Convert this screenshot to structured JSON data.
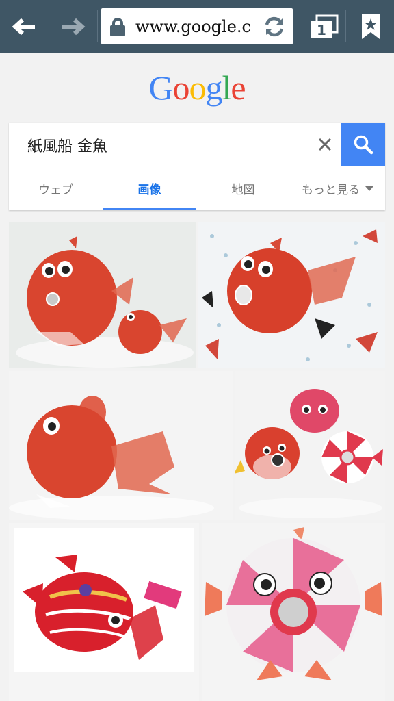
{
  "browser": {
    "url": "www.google.c",
    "tab_count": "1",
    "icons": [
      "back-arrow-icon",
      "forward-arrow-icon",
      "lock-icon",
      "reload-icon",
      "tabs-icon",
      "bookmark-icon"
    ]
  },
  "google": {
    "logo": [
      "G",
      "o",
      "o",
      "g",
      "l",
      "e"
    ],
    "logo_colors": [
      "#4285f4",
      "#ea4335",
      "#fbbc05",
      "#4285f4",
      "#34a853",
      "#ea4335"
    ]
  },
  "search": {
    "query": "紙風船 金魚",
    "accent": "#4285f4"
  },
  "tabs": {
    "web": "ウェブ",
    "images": "画像",
    "maps": "地図",
    "more": "もっと見る"
  },
  "results": {
    "images": [
      {
        "alt": "paper balloon goldfish pair"
      },
      {
        "alt": "paper balloon goldfish on tenugui"
      },
      {
        "alt": "paper balloon goldfish side view"
      },
      {
        "alt": "three paper balloon pufferfish"
      },
      {
        "alt": "red paper balloon goldfish with package"
      },
      {
        "alt": "pink paper balloon pufferfish"
      }
    ]
  }
}
